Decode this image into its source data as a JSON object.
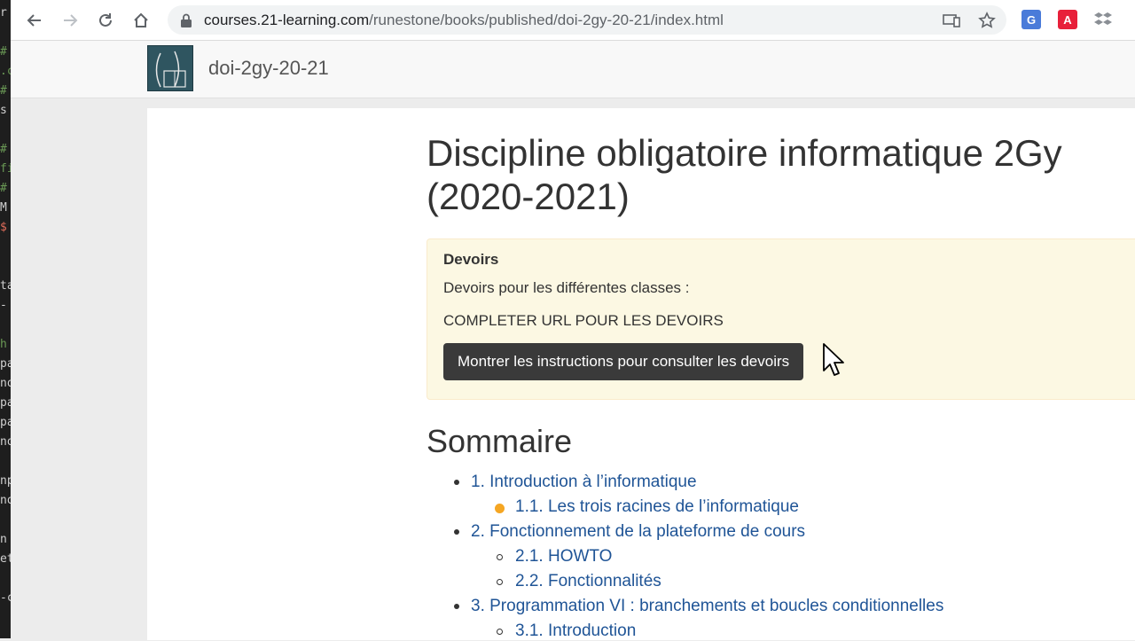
{
  "browser": {
    "url_host": "courses.21-learning.com",
    "url_path": "/runestone/books/published/doi-2gy-20-21/index.html"
  },
  "site": {
    "brand": "doi-2gy-20-21"
  },
  "page": {
    "title": "Discipline obligatoire informatique 2Gy (2020-2021)",
    "alert": {
      "title": "Devoirs",
      "line1": "Devoirs pour les différentes classes :",
      "line2": "COMPLETER URL POUR LES DEVOIRS",
      "button": "Montrer les instructions pour consulter les devoirs"
    },
    "toc_title": "Sommaire",
    "toc": [
      {
        "label": "1. Introduction à l’informatique"
      },
      {
        "label": "1.1. Les trois racines de l’informatique"
      },
      {
        "label": "2. Fonctionnement de la plateforme de cours"
      },
      {
        "label": "2.1. HOWTO"
      },
      {
        "label": "2.2. Fonctionnalités"
      },
      {
        "label": "3. Programmation VI : branchements et boucles conditionnelles"
      },
      {
        "label": "3.1. Introduction"
      }
    ]
  },
  "colors": {
    "link": "#1f5496",
    "alert_bg": "#fcf8e3",
    "button_bg": "#3a3a3a",
    "progress_dot": "#f5a623"
  }
}
